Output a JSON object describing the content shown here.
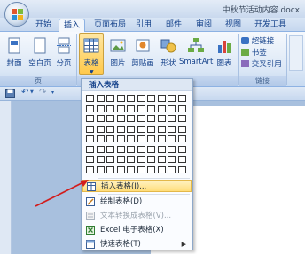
{
  "window": {
    "title": "中秋节活动内容.docx"
  },
  "tabs": [
    {
      "label": "开始"
    },
    {
      "label": "插入"
    },
    {
      "label": "页面布局"
    },
    {
      "label": "引用"
    },
    {
      "label": "邮件"
    },
    {
      "label": "审阅"
    },
    {
      "label": "视图"
    },
    {
      "label": "开发工具"
    }
  ],
  "ribbon": {
    "pages_group": {
      "label": "页",
      "cover": "封面",
      "blank": "空白页",
      "break": "分页"
    },
    "table": {
      "label": "表格"
    },
    "illustrations": {
      "picture": "图片",
      "clipart": "剪贴画",
      "shapes": "形状",
      "smartart": "SmartArt",
      "chart": "图表"
    },
    "links": {
      "label": "链接",
      "hyperlink": "超链接",
      "bookmark": "书签",
      "crossref": "交叉引用"
    }
  },
  "dropdown": {
    "header": "插入表格",
    "items": [
      {
        "label": "插入表格(I)...",
        "icon": "insert-table-icon"
      },
      {
        "label": "绘制表格(D)",
        "icon": "draw-table-icon"
      },
      {
        "label": "文本转换成表格(V)...",
        "icon": "convert-text-icon"
      },
      {
        "label": "Excel 电子表格(X)",
        "icon": "excel-icon"
      },
      {
        "label": "快速表格(T)",
        "icon": "quick-table-icon"
      }
    ]
  }
}
